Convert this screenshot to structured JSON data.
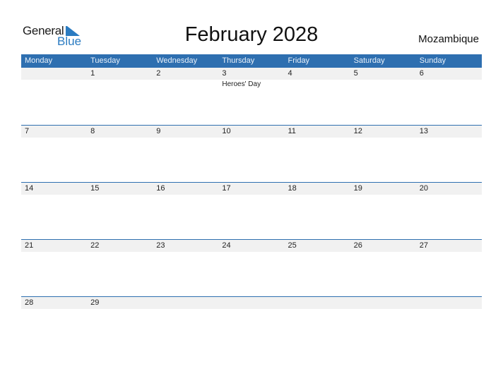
{
  "logo": {
    "word1": "General",
    "word2": "Blue"
  },
  "title": "February 2028",
  "country": "Mozambique",
  "colors": {
    "accent": "#2e6fb0",
    "row_bg": "#f1f1f1",
    "logo_blue": "#2a7bc1"
  },
  "weekdays": [
    "Monday",
    "Tuesday",
    "Wednesday",
    "Thursday",
    "Friday",
    "Saturday",
    "Sunday"
  ],
  "weeks": [
    {
      "days": [
        "",
        "1",
        "2",
        "3",
        "4",
        "5",
        "6"
      ],
      "events": [
        "",
        "",
        "",
        "Heroes' Day",
        "",
        "",
        ""
      ]
    },
    {
      "days": [
        "7",
        "8",
        "9",
        "10",
        "11",
        "12",
        "13"
      ],
      "events": [
        "",
        "",
        "",
        "",
        "",
        "",
        ""
      ]
    },
    {
      "days": [
        "14",
        "15",
        "16",
        "17",
        "18",
        "19",
        "20"
      ],
      "events": [
        "",
        "",
        "",
        "",
        "",
        "",
        ""
      ]
    },
    {
      "days": [
        "21",
        "22",
        "23",
        "24",
        "25",
        "26",
        "27"
      ],
      "events": [
        "",
        "",
        "",
        "",
        "",
        "",
        ""
      ]
    },
    {
      "days": [
        "28",
        "29",
        "",
        "",
        "",
        "",
        ""
      ],
      "events": [
        "",
        "",
        "",
        "",
        "",
        "",
        ""
      ]
    }
  ]
}
